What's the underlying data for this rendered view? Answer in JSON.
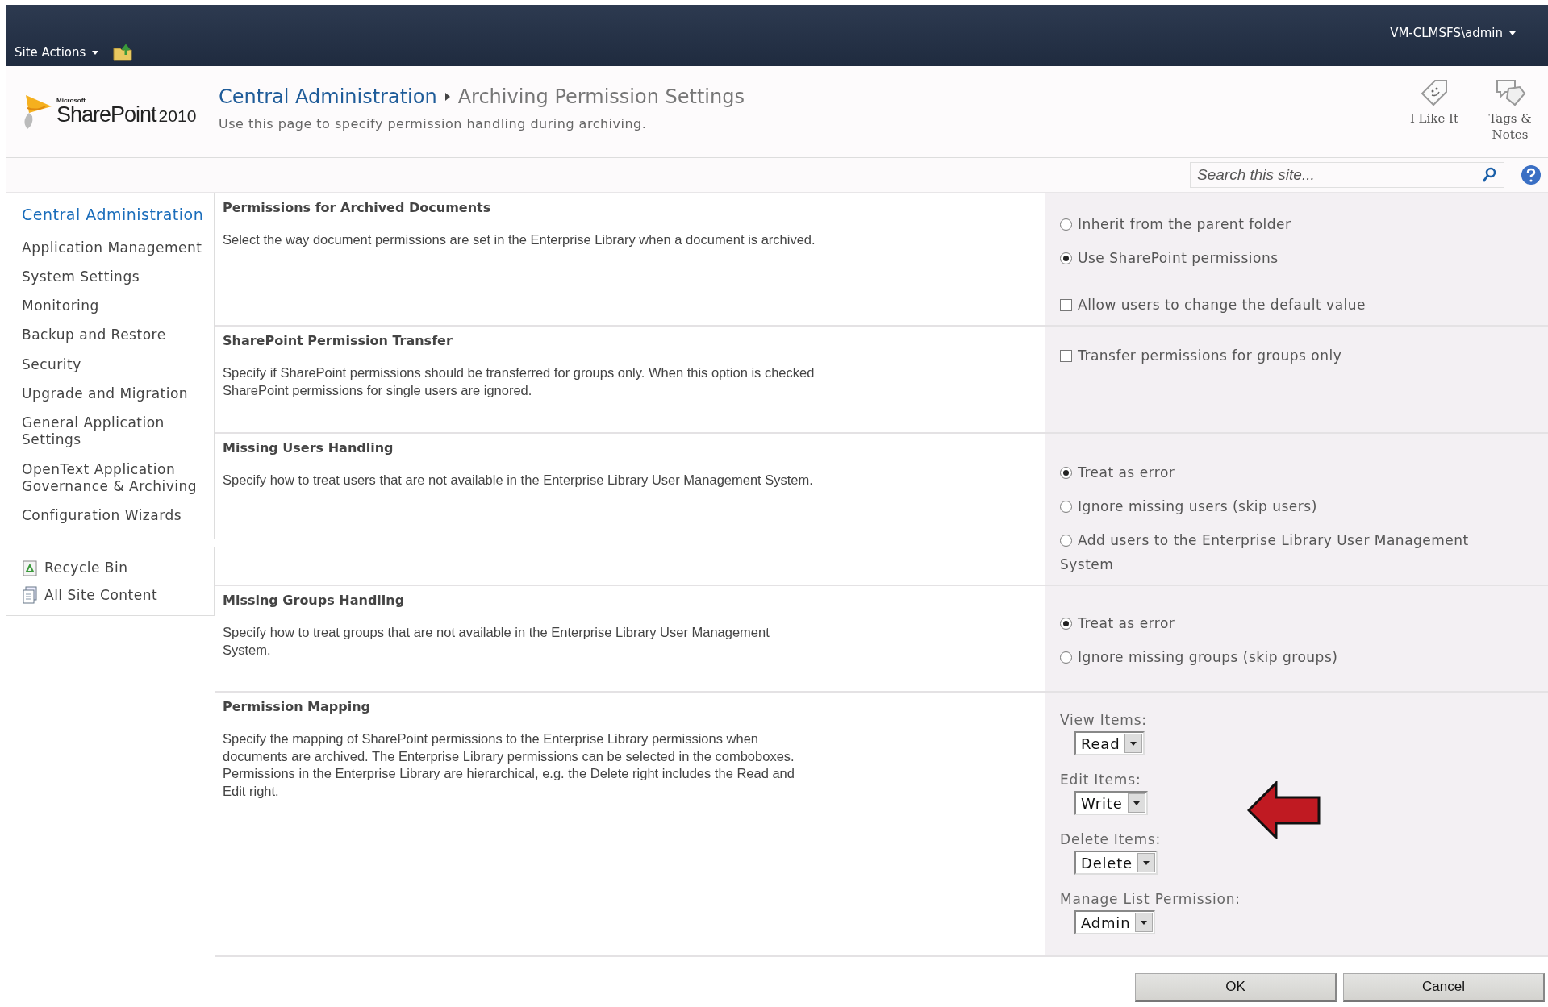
{
  "top_bar": {
    "site_actions": "Site Actions",
    "user": "VM-CLMSFS\\admin"
  },
  "header": {
    "logo": {
      "maker": "Microsoft",
      "product": "SharePoint",
      "version": "2010"
    },
    "breadcrumb": [
      "Central Administration",
      "Archiving Permission Settings"
    ],
    "description": "Use this page to specify permission handling during archiving.",
    "actions": [
      {
        "kind": "like",
        "label": "I Like It"
      },
      {
        "kind": "tags",
        "label": "Tags & Notes"
      }
    ]
  },
  "search": {
    "placeholder": "Search this site..."
  },
  "nav": {
    "heading": "Central Administration",
    "items": [
      "Application Management",
      "System Settings",
      "Monitoring",
      "Backup and Restore",
      "Security",
      "Upgrade and Migration",
      "General Application Settings",
      "OpenText Application Governance & Archiving",
      "Configuration Wizards"
    ],
    "links": [
      {
        "kind": "recycle",
        "label": "Recycle Bin"
      },
      {
        "kind": "content",
        "label": "All Site Content"
      }
    ]
  },
  "sections": [
    {
      "title": "Permissions for Archived Documents",
      "description": "Select the way document permissions are set in the Enterprise Library when a document is archived.",
      "options": [
        {
          "kind": "radio",
          "label": "Inherit from the parent folder",
          "checked": false
        },
        {
          "kind": "radio",
          "label": "Use SharePoint permissions",
          "checked": true
        },
        {
          "kind": "checkbox",
          "label": "Allow users to change the default value",
          "checked": false
        }
      ]
    },
    {
      "title": "SharePoint Permission Transfer",
      "description": "Specify if SharePoint permissions should be transferred for groups only. When this option is checked SharePoint permissions for single users are ignored.",
      "options": [
        {
          "kind": "checkbox",
          "label": "Transfer permissions for groups only",
          "checked": false
        }
      ]
    },
    {
      "title": "Missing Users Handling",
      "description": "Specify how to treat users that are not available in the Enterprise Library User Management System.",
      "options": [
        {
          "kind": "radio",
          "label": "Treat as error",
          "checked": true
        },
        {
          "kind": "radio",
          "label": "Ignore missing users (skip users)",
          "checked": false
        },
        {
          "kind": "radio",
          "label": "Add users to the Enterprise Library User Management System",
          "checked": false
        }
      ]
    },
    {
      "title": "Missing Groups Handling",
      "description": "Specify how to treat groups that are not available in the Enterprise Library User Management System.",
      "options": [
        {
          "kind": "radio",
          "label": "Treat as error",
          "checked": true
        },
        {
          "kind": "radio",
          "label": "Ignore missing groups (skip groups)",
          "checked": false
        }
      ]
    },
    {
      "title": "Permission Mapping",
      "description": "Specify the mapping of SharePoint permissions to the Enterprise Library permissions when documents are archived. The Enterprise Library permissions can be selected in the comboboxes. Permissions in the Enterprise Library are hierarchical, e.g. the Delete right includes the Read and Edit right.",
      "options": [
        {
          "kind": "select",
          "label": "View Items:",
          "value": "Read"
        },
        {
          "kind": "select",
          "label": "Edit Items:",
          "value": "Write"
        },
        {
          "kind": "select",
          "label": "Delete Items:",
          "value": "Delete"
        },
        {
          "kind": "select",
          "label": "Manage List Permission:",
          "value": "Admin"
        }
      ]
    }
  ],
  "buttons": [
    "OK",
    "Cancel"
  ]
}
